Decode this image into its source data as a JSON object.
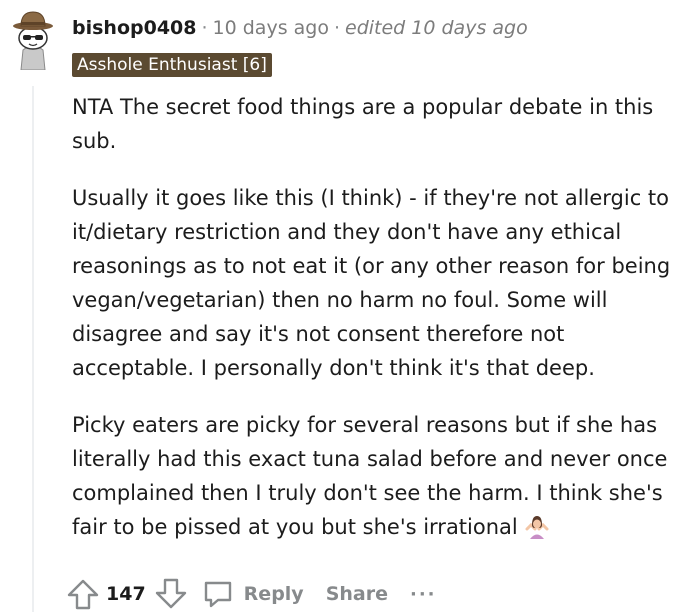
{
  "comment": {
    "username": "bishop0408",
    "separator": "·",
    "time": "10 days ago",
    "separator2": "·",
    "edited": "edited 10 days ago",
    "flair": "Asshole Enthusiast [6]",
    "paragraphs": [
      "NTA The secret food things are a popular debate in this sub.",
      "Usually it goes like this (I think) - if they're not allergic to it/dietary restriction and they don't have any ethical reasonings as to not eat it (or any other reason for being vegan/vegetarian) then no harm no foul. Some will disagree and say it's not consent therefore not acceptable. I personally don't think it's that deep.",
      "Picky eaters are picky for several reasons but if she has literally had this exact tuna salad before and never once complained then I truly don't see the harm. I think she's fair to be pissed at you but she's irrational"
    ],
    "end_emoji": "woman-shrugging-emoji"
  },
  "actions": {
    "upvote_icon": "upvote-arrow-icon",
    "score": "147",
    "downvote_icon": "downvote-arrow-icon",
    "reply_icon": "speech-bubble-icon",
    "reply_label": "Reply",
    "share_label": "Share",
    "more_label": "···"
  },
  "colors": {
    "flair_bg": "#5b4a31",
    "meta_gray": "#7c7c7c",
    "action_gray": "#878a8c",
    "thread_line": "#edeff1"
  }
}
